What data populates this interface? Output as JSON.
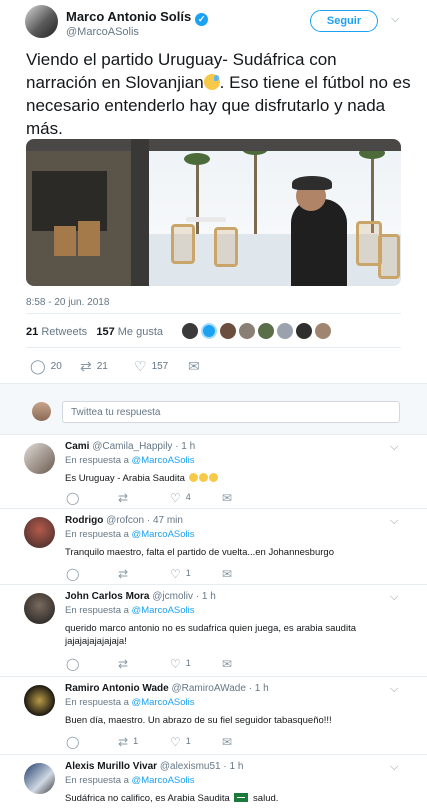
{
  "main_tweet": {
    "author_name": "Marco Antonio Solís",
    "author_handle": "@MarcoASolis",
    "follow_label": "Seguir",
    "text_before_emoji": "Viendo el partido Uruguay- Sudáfrica con narración en Slovanjian",
    "text_after_emoji": ". Eso tiene el fútbol no es necesario entenderlo hay que disfrutarlo y nada más.",
    "timestamp": "8:58 - 20 jun. 2018",
    "retweets_count": "21",
    "retweets_label": "Retweets",
    "likes_count": "157",
    "likes_label": "Me gusta",
    "reply_count": "20",
    "retweet_count": "21",
    "like_count": "157"
  },
  "reply_box": {
    "placeholder": "Twittea tu respuesta"
  },
  "replies": [
    {
      "name": "Cami",
      "handle": "@Camila_Happily",
      "time": "· 1 h",
      "in_reply_prefix": "En respuesta a",
      "in_reply_handle": "@MarcoASolis",
      "text": "Es Uruguay  - Arabia Saudita",
      "like_count": "4"
    },
    {
      "name": "Rodrigo",
      "handle": "@rofcon",
      "time": "· 47 min",
      "in_reply_prefix": "En respuesta a",
      "in_reply_handle": "@MarcoASolis",
      "text": "Tranquilo maestro, falta el partido de vuelta...en Johannesburgo",
      "like_count": "1"
    },
    {
      "name": "John Carlos Mora",
      "handle": "@jcmoliv",
      "time": "· 1 h",
      "in_reply_prefix": "En respuesta a",
      "in_reply_handle": "@MarcoASolis",
      "text": "querido marco antonio no es sudafrica quien juega, es arabia saudita jajajajajajajaja!",
      "like_count": "1"
    },
    {
      "name": "Ramiro Antonio Wade",
      "handle": "@RamiroAWade",
      "time": "· 1 h",
      "in_reply_prefix": "En respuesta a",
      "in_reply_handle": "@MarcoASolis",
      "text": "Buen día, maestro. Un abrazo de su fiel seguidor tabasqueño!!!",
      "retweet_count": "1",
      "like_count": "1"
    },
    {
      "name": "Alexis Murillo Vivar",
      "handle": "@alexismu51",
      "time": "· 1 h",
      "in_reply_prefix": "En respuesta a",
      "in_reply_handle": "@MarcoASolis",
      "text_before_flag": "Sudáfrica no califico, es Arabia Saudita",
      "text_after_flag": "salud."
    }
  ],
  "colors": {
    "accent": "#1da1f2",
    "muted": "#657786",
    "text": "#14171a"
  },
  "icons": [
    "verified-badge-icon",
    "chevron-down-icon",
    "reply-icon",
    "retweet-icon",
    "heart-icon",
    "direct-message-icon"
  ]
}
